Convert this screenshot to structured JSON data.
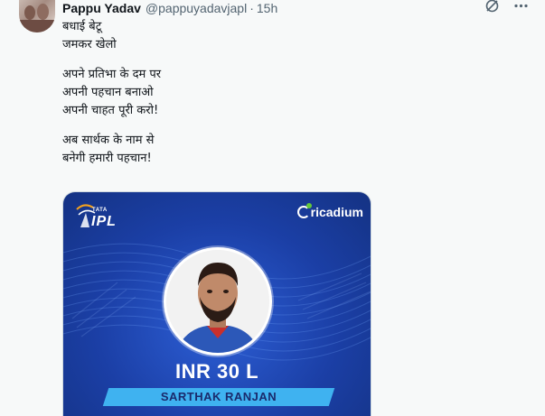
{
  "tweet": {
    "author_name": "Pappu Yadav",
    "handle": "@pappuyadavjapl",
    "separator": "·",
    "time": "15h",
    "text_lines": [
      "बधाई बेटू",
      "जमकर खेलो",
      "",
      "अपने प्रतिभा के दम पर",
      "अपनी पहचान बनाओ",
      "अपनी चाहत पूरी करो!",
      "",
      "अब सार्थक के नाम से",
      "बनेगी हमारी पहचान!"
    ],
    "icons": [
      "grok-icon",
      "more-icon"
    ]
  },
  "card": {
    "league_sponsor": "TATA",
    "league": "IPL",
    "brand": "ricadium",
    "price": "INR 30 L",
    "player_name": "SARTHAK RANJAN",
    "colors": {
      "background": "#1b3fa6",
      "banner": "#3fb2f0",
      "banner_text": "#1a2a6c",
      "brand_dot": "#63c83a"
    }
  }
}
